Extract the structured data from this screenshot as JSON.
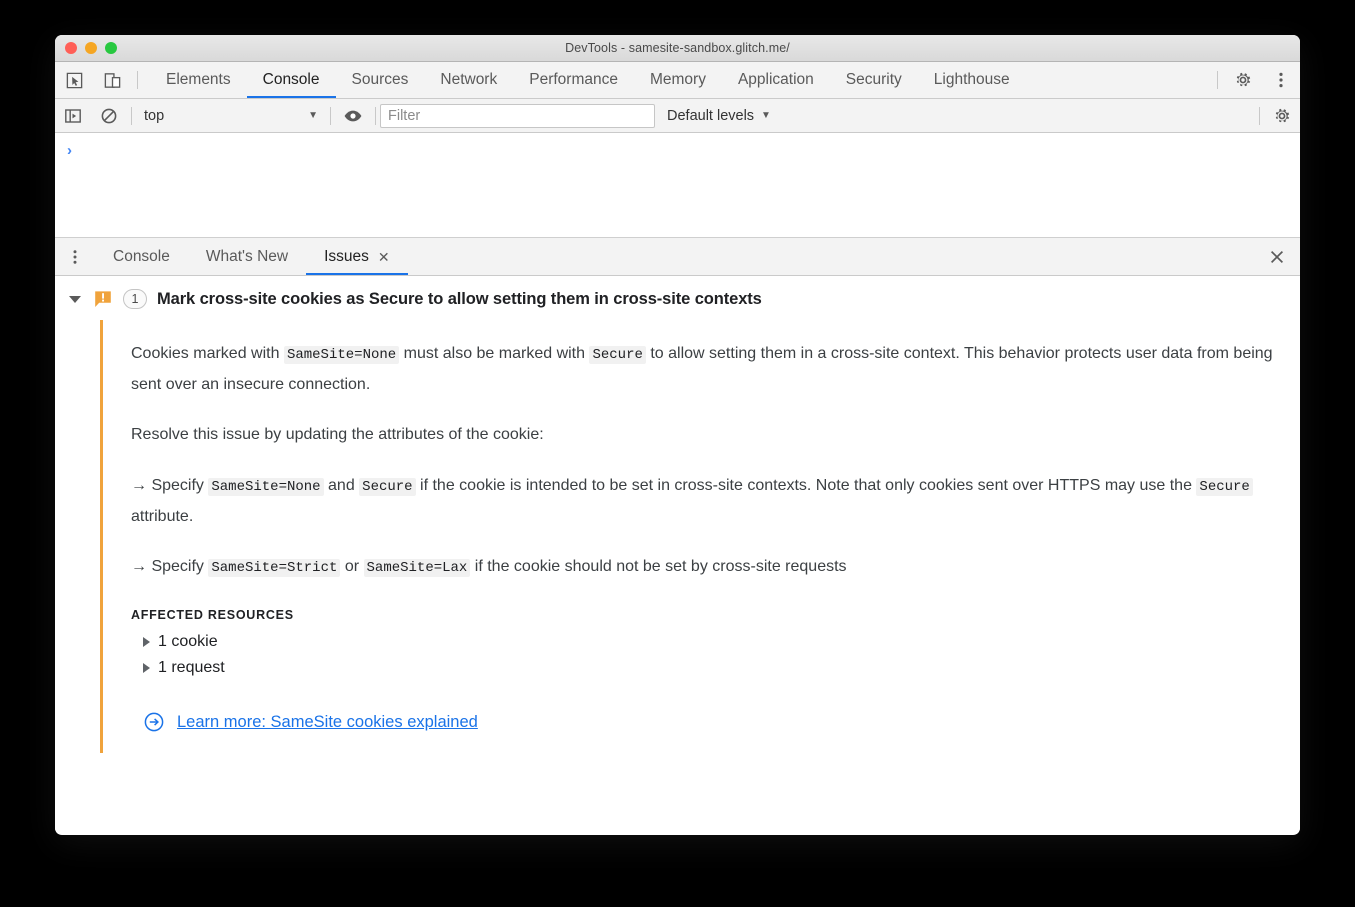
{
  "window": {
    "title": "DevTools - samesite-sandbox.glitch.me/",
    "traffic_lights": [
      "close",
      "minimize",
      "zoom"
    ]
  },
  "main_tabbar": {
    "inspect_icon": "inspect-cursor-icon",
    "device_toolbar_icon": "device-toolbar-icon",
    "tabs": [
      {
        "label": "Elements",
        "active": false
      },
      {
        "label": "Console",
        "active": true
      },
      {
        "label": "Sources",
        "active": false
      },
      {
        "label": "Network",
        "active": false
      },
      {
        "label": "Performance",
        "active": false
      },
      {
        "label": "Memory",
        "active": false
      },
      {
        "label": "Application",
        "active": false
      },
      {
        "label": "Security",
        "active": false
      },
      {
        "label": "Lighthouse",
        "active": false
      }
    ],
    "settings_icon": "gear-icon",
    "more_icon": "kebab-menu-icon"
  },
  "console_toolbar": {
    "sidebar_toggle_icon": "console-sidebar-toggle-icon",
    "clear_icon": "clear-console-icon",
    "context": {
      "value": "top",
      "caret": "▼"
    },
    "eye_icon": "live-expression-eye-icon",
    "filter": {
      "value": "",
      "placeholder": "Filter"
    },
    "levels": {
      "value": "Default levels",
      "caret": "▼"
    },
    "settings_icon": "gear-icon"
  },
  "console_output": {
    "prompt": "›"
  },
  "drawer": {
    "menu_icon": "kebab-menu-icon",
    "tabs": [
      {
        "label": "Console",
        "active": false,
        "closable": false
      },
      {
        "label": "What's New",
        "active": false,
        "closable": false
      },
      {
        "label": "Issues",
        "active": true,
        "closable": true,
        "close_glyph": "✕"
      }
    ],
    "close_icon": "close-icon",
    "close_glyph": "✕"
  },
  "issue": {
    "severity_icon": "warning-bubble-icon",
    "severity_glyph": "!",
    "severity_color": "#f0a33c",
    "count_badge": "1",
    "title": "Mark cross-site cookies as Secure to allow setting them in cross-site contexts",
    "paragraph1": {
      "part1": "Cookies marked with ",
      "code1": "SameSite=None",
      "part2": " must also be marked with ",
      "code2": "Secure",
      "part3": " to allow setting them in a cross-site context. This behavior protects user data from being sent over an insecure connection."
    },
    "paragraph2": "Resolve this issue by updating the attributes of the cookie:",
    "bullet1": {
      "arrow": "→",
      "part1": " Specify ",
      "code1": "SameSite=None",
      "part2": " and ",
      "code2": "Secure",
      "part3": " if the cookie is intended to be set in cross-site contexts. Note that only cookies sent over HTTPS may use the ",
      "code3": "Secure",
      "part4": " attribute."
    },
    "bullet2": {
      "arrow": "→",
      "part1": " Specify ",
      "code1": "SameSite=Strict",
      "part2": " or ",
      "code2": "SameSite=Lax",
      "part3": " if the cookie should not be set by cross-site requests"
    },
    "affected_resources_label": "AFFECTED RESOURCES",
    "resources": [
      {
        "label": "1 cookie",
        "expanded": false
      },
      {
        "label": "1 request",
        "expanded": false
      }
    ],
    "learn_more": {
      "icon": "circled-arrow-right-icon",
      "text": "Learn more: SameSite cookies explained",
      "color": "#1a73e8"
    }
  }
}
